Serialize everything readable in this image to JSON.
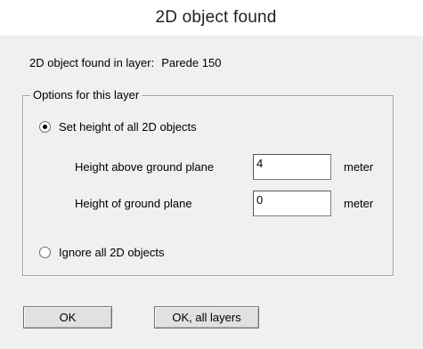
{
  "dialog": {
    "title": "2D object found"
  },
  "found": {
    "label": "2D object found in layer:",
    "layer_name": "Parede 150"
  },
  "options": {
    "legend": "Options for this layer",
    "set_height": {
      "label": "Set height of all 2D objects",
      "checked": true
    },
    "height_above": {
      "label": "Height above ground plane",
      "value": "4",
      "unit": "meter"
    },
    "ground_height": {
      "label": "Height of ground plane",
      "value": "0",
      "unit": "meter"
    },
    "ignore": {
      "label": "Ignore all 2D objects",
      "checked": false
    }
  },
  "buttons": {
    "ok_label": "OK",
    "ok_all_label": "OK, all layers"
  }
}
